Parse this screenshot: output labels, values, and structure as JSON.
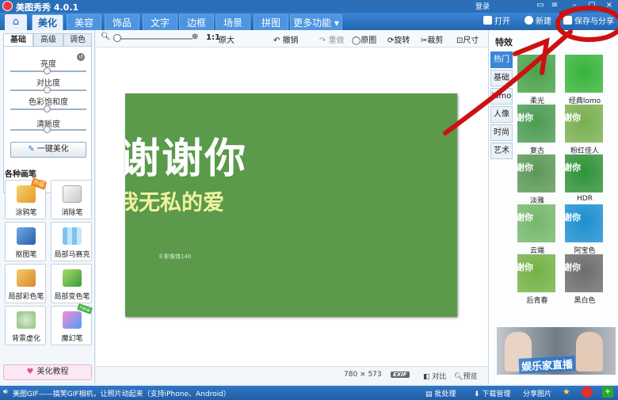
{
  "app": {
    "title": "美图秀秀 4.0.1",
    "login": "登录"
  },
  "nav": {
    "tabs": [
      "美化",
      "美容",
      "饰品",
      "文字",
      "边框",
      "场景",
      "拼图",
      "更多功能 ▾"
    ],
    "open": "打开",
    "new": "新建",
    "save_share": "保存与分享"
  },
  "left": {
    "subtabs": [
      "基础",
      "高级",
      "调色"
    ],
    "adjustments": [
      {
        "label": "亮度",
        "level": 0.48
      },
      {
        "label": "对比度",
        "level": 0.48
      },
      {
        "label": "色彩饱和度",
        "level": 0.48
      },
      {
        "label": "清晰度",
        "level": 0.48
      }
    ],
    "onekey": "一键美化",
    "brushes_title": "各种画笔",
    "tools": [
      "涂鸦笔",
      "消除笔",
      "抠图笔",
      "局部马赛克",
      "局部彩色笔",
      "局部变色笔",
      "背景虚化",
      "魔幻笔"
    ],
    "badge_hot": "升级",
    "badge_new": "new",
    "tutorial": "美化教程"
  },
  "toolbar": {
    "ratio": "1:1",
    "original_size": "原大",
    "undo": "撤销",
    "redo": "重做",
    "original": "原图",
    "rotate": "旋转",
    "crop": "裁剪",
    "size": "尺寸"
  },
  "photo": {
    "big_text": "谢谢你",
    "mid_text": "我无私的爱",
    "small_text": "©影像馆140"
  },
  "status": {
    "dimensions": "780 × 573",
    "exif": "EXIF",
    "compare": "对比",
    "preview": "预览"
  },
  "right": {
    "title": "特效",
    "categories": [
      "热门",
      "基础",
      "lomo",
      "人像",
      "时尚",
      "艺术"
    ],
    "effects": [
      {
        "name": "柔光",
        "color": "#4aa24a"
      },
      {
        "name": "经典lomo",
        "color": "#38b43a"
      },
      {
        "name": "复古",
        "color": "#4c9c52"
      },
      {
        "name": "粉红佳人",
        "color": "#78b050"
      },
      {
        "name": "淡雅",
        "color": "#5c9856"
      },
      {
        "name": "HDR",
        "color": "#2f9238"
      },
      {
        "name": "云端",
        "color": "#75b86a"
      },
      {
        "name": "阿宝色",
        "color": "#1c8fd0"
      },
      {
        "name": "后青春",
        "color": "#74b244"
      },
      {
        "name": "黑白色",
        "color": "#6d6d6d"
      }
    ],
    "thumb_text": "谢你",
    "ad_text": "娱乐家直播"
  },
  "bottom": {
    "tip": "美图GIF——搞笑GIF相机，让照片动起来（支持iPhone、Android）",
    "batch": "批处理",
    "downloads": "下载管理",
    "share": "分享图片"
  },
  "colors": {
    "accent": "#2a6fb8",
    "annotation": "#cc1111",
    "photo_bg": "#5a9a4a"
  }
}
